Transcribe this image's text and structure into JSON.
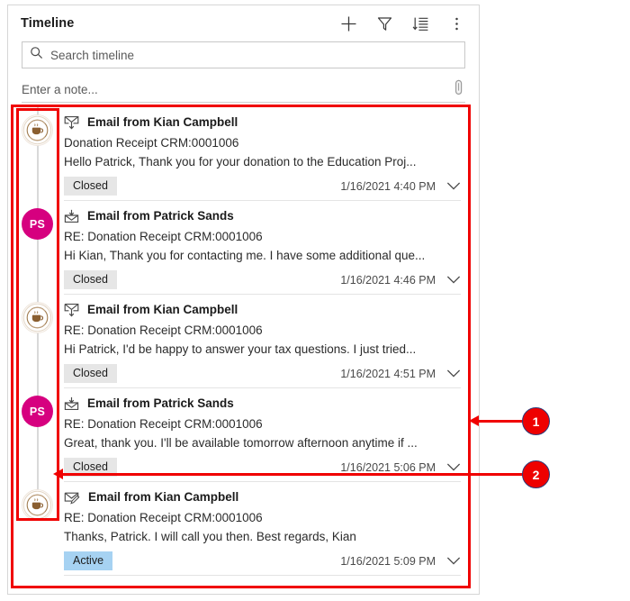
{
  "panel": {
    "title": "Timeline",
    "header_actions": [
      {
        "name": "add-icon",
        "label": "Add"
      },
      {
        "name": "filter-icon",
        "label": "Filter"
      },
      {
        "name": "sort-icon",
        "label": "Sort"
      },
      {
        "name": "more-options-icon",
        "label": "More commands"
      }
    ],
    "search": {
      "placeholder": "Search timeline",
      "value": "",
      "icon": "search-icon"
    },
    "note": {
      "placeholder": "Enter a note...",
      "value": "",
      "attach_icon": "paperclip-icon"
    }
  },
  "colors": {
    "annotation_red": "#ee0000",
    "avatar_pink": "#d6007f",
    "badge_closed_bg": "#e6e6e6",
    "badge_active_bg": "#a6d2f2",
    "rail_line": "#d9d9d9",
    "panel_border": "#d6d6d6"
  },
  "records": [
    {
      "title": "Email from Kian Campbell",
      "subject": "Donation Receipt CRM:0001006",
      "preview": "Hello Patrick,   Thank you for your donation to the Education Proj...",
      "status": "Closed",
      "status_kind": "closed",
      "timestamp": "1/16/2021 4:40 PM",
      "icon": "email-sent-icon",
      "avatar_kind": "logo",
      "avatar_initials": ""
    },
    {
      "title": "Email from Patrick Sands",
      "subject": "RE: Donation Receipt CRM:0001006",
      "preview": "Hi Kian, Thank you for contacting me. I have some additional que...",
      "status": "Closed",
      "status_kind": "closed",
      "timestamp": "1/16/2021 4:46 PM",
      "icon": "email-received-icon",
      "avatar_kind": "initials",
      "avatar_initials": "PS"
    },
    {
      "title": "Email from Kian Campbell",
      "subject": "RE: Donation Receipt CRM:0001006",
      "preview": "Hi Patrick,   I'd be happy to answer your tax questions. I just tried...",
      "status": "Closed",
      "status_kind": "closed",
      "timestamp": "1/16/2021 4:51 PM",
      "icon": "email-sent-icon",
      "avatar_kind": "logo",
      "avatar_initials": ""
    },
    {
      "title": "Email from Patrick Sands",
      "subject": "RE: Donation Receipt CRM:0001006",
      "preview": "Great, thank you. I'll be available tomorrow afternoon anytime if ...",
      "status": "Closed",
      "status_kind": "closed",
      "timestamp": "1/16/2021 5:06 PM",
      "icon": "email-received-icon",
      "avatar_kind": "initials",
      "avatar_initials": "PS"
    },
    {
      "title": "Email from Kian Campbell",
      "subject": "RE: Donation Receipt CRM:0001006",
      "preview": "Thanks, Patrick. I will call you then.   Best regards, Kian",
      "status": "Active",
      "status_kind": "active",
      "timestamp": "1/16/2021 5:09 PM",
      "icon": "email-draft-icon",
      "avatar_kind": "logo",
      "avatar_initials": ""
    }
  ],
  "annotations": [
    {
      "number": "1"
    },
    {
      "number": "2"
    }
  ]
}
